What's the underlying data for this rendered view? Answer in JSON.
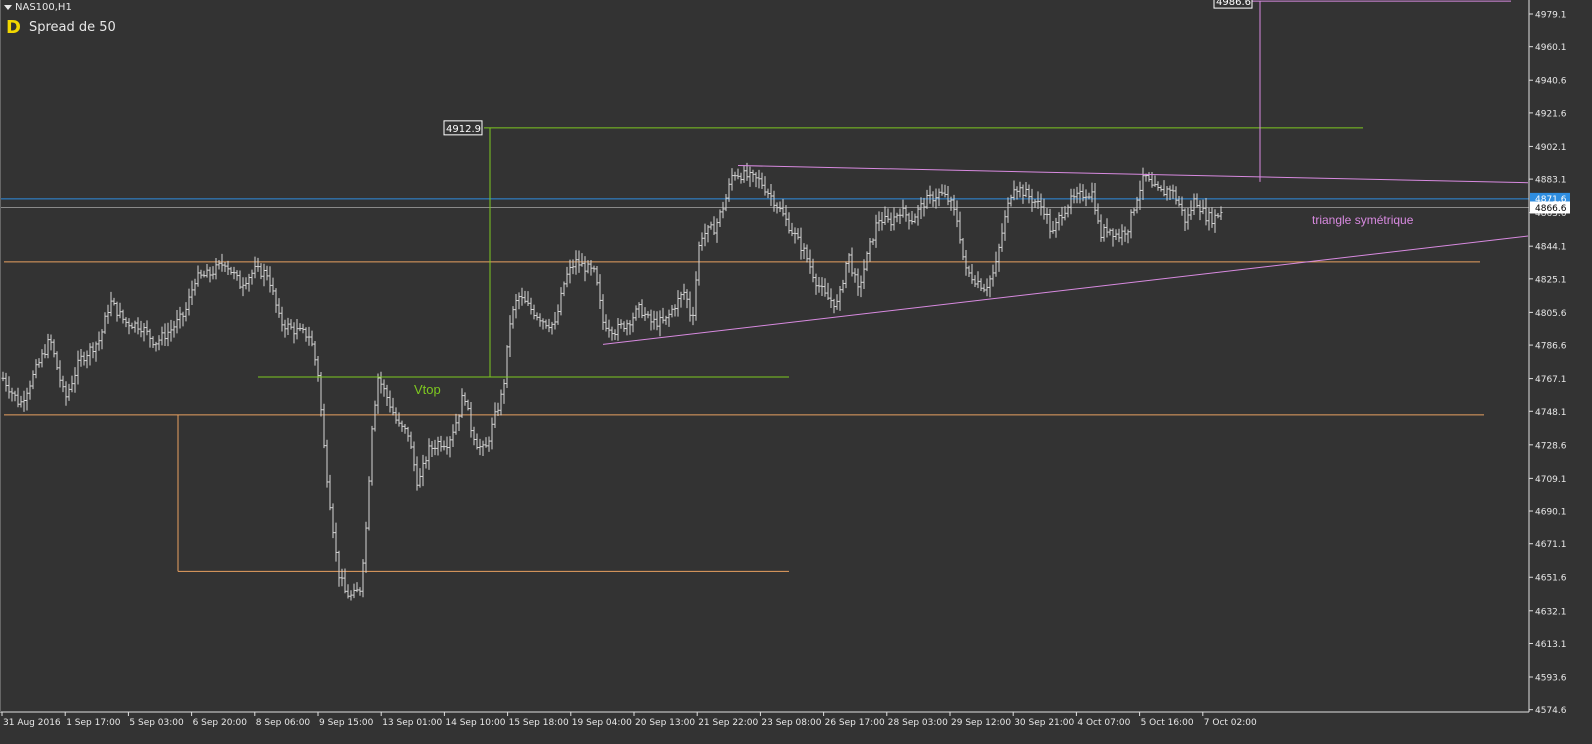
{
  "header": {
    "symbol": "NAS100,H1",
    "spread_text": "Spread de 50",
    "logo_letter": "D"
  },
  "colors": {
    "background": "#333333",
    "grid_text": "#e8e8e8",
    "bars": "#d4d4d4",
    "green": "#7ec820",
    "orange": "#e8a060",
    "violet": "#d88ae0",
    "blue": "#2e8de0",
    "price_line": "#8a8a8a",
    "axis": "#e0e0e0"
  },
  "price_axis": {
    "ticks": [
      "4979.1",
      "4960.1",
      "4940.6",
      "4921.6",
      "4902.1",
      "4883.1",
      "4863.6",
      "4844.1",
      "4825.1",
      "4805.6",
      "4786.6",
      "4767.1",
      "4748.1",
      "4728.6",
      "4709.1",
      "4690.1",
      "4671.1",
      "4651.6",
      "4632.1",
      "4613.1",
      "4593.6",
      "4574.6"
    ],
    "current_bid_label": "4866.6",
    "blue_line_label": "4871.6",
    "range": [
      4566,
      4992
    ]
  },
  "time_axis": {
    "labels": [
      "31 Aug 2016",
      "1 Sep 17:00",
      "5 Sep 03:00",
      "6 Sep 20:00",
      "8 Sep 06:00",
      "9 Sep 15:00",
      "13 Sep 01:00",
      "14 Sep 10:00",
      "15 Sep 18:00",
      "19 Sep 04:00",
      "20 Sep 13:00",
      "21 Sep 22:00",
      "23 Sep 08:00",
      "26 Sep 17:00",
      "28 Sep 03:00",
      "29 Sep 12:00",
      "30 Sep 21:00",
      "4 Oct 07:00",
      "5 Oct 16:00",
      "7 Oct 02:00"
    ]
  },
  "annotations": {
    "vtop_label": "Vtop",
    "vtop_target_label": "4912.9",
    "triangle_label": "triangle symétrique",
    "triangle_target_label": "4986.6"
  },
  "chart_data": {
    "type": "ohlc",
    "symbol": "NAS100",
    "timeframe": "H1",
    "anchors": [
      [
        0,
        4770
      ],
      [
        20,
        4752
      ],
      [
        50,
        4790
      ],
      [
        65,
        4755
      ],
      [
        80,
        4778
      ],
      [
        100,
        4790
      ],
      [
        110,
        4812
      ],
      [
        125,
        4800
      ],
      [
        140,
        4798
      ],
      [
        155,
        4788
      ],
      [
        170,
        4795
      ],
      [
        185,
        4805
      ],
      [
        195,
        4825
      ],
      [
        210,
        4828
      ],
      [
        225,
        4835
      ],
      [
        240,
        4822
      ],
      [
        255,
        4830
      ],
      [
        268,
        4828
      ],
      [
        280,
        4800
      ],
      [
        295,
        4795
      ],
      [
        310,
        4792
      ],
      [
        318,
        4770
      ],
      [
        325,
        4720
      ],
      [
        333,
        4680
      ],
      [
        338,
        4655
      ],
      [
        345,
        4643
      ],
      [
        352,
        4640
      ],
      [
        360,
        4645
      ],
      [
        366,
        4680
      ],
      [
        372,
        4740
      ],
      [
        378,
        4768
      ],
      [
        388,
        4755
      ],
      [
        398,
        4740
      ],
      [
        408,
        4735
      ],
      [
        418,
        4705
      ],
      [
        428,
        4725
      ],
      [
        438,
        4730
      ],
      [
        448,
        4730
      ],
      [
        458,
        4745
      ],
      [
        464,
        4760
      ],
      [
        470,
        4740
      ],
      [
        478,
        4728
      ],
      [
        485,
        4725
      ],
      [
        495,
        4745
      ],
      [
        503,
        4760
      ],
      [
        510,
        4800
      ],
      [
        518,
        4815
      ],
      [
        530,
        4808
      ],
      [
        545,
        4800
      ],
      [
        555,
        4798
      ],
      [
        565,
        4825
      ],
      [
        575,
        4835
      ],
      [
        585,
        4832
      ],
      [
        595,
        4828
      ],
      [
        603,
        4800
      ],
      [
        615,
        4795
      ],
      [
        628,
        4800
      ],
      [
        640,
        4808
      ],
      [
        650,
        4800
      ],
      [
        665,
        4800
      ],
      [
        675,
        4810
      ],
      [
        685,
        4818
      ],
      [
        692,
        4800
      ],
      [
        700,
        4850
      ],
      [
        715,
        4855
      ],
      [
        725,
        4870
      ],
      [
        733,
        4887
      ],
      [
        745,
        4885
      ],
      [
        760,
        4882
      ],
      [
        775,
        4870
      ],
      [
        785,
        4860
      ],
      [
        795,
        4850
      ],
      [
        805,
        4840
      ],
      [
        815,
        4825
      ],
      [
        825,
        4815
      ],
      [
        838,
        4810
      ],
      [
        848,
        4840
      ],
      [
        858,
        4818
      ],
      [
        868,
        4840
      ],
      [
        878,
        4860
      ],
      [
        890,
        4858
      ],
      [
        900,
        4865
      ],
      [
        912,
        4860
      ],
      [
        925,
        4870
      ],
      [
        940,
        4875
      ],
      [
        950,
        4870
      ],
      [
        958,
        4858
      ],
      [
        965,
        4830
      ],
      [
        975,
        4825
      ],
      [
        985,
        4820
      ],
      [
        995,
        4830
      ],
      [
        1003,
        4855
      ],
      [
        1013,
        4880
      ],
      [
        1025,
        4875
      ],
      [
        1035,
        4870
      ],
      [
        1045,
        4865
      ],
      [
        1052,
        4850
      ],
      [
        1060,
        4862
      ],
      [
        1070,
        4870
      ],
      [
        1085,
        4875
      ],
      [
        1093,
        4875
      ],
      [
        1100,
        4850
      ],
      [
        1108,
        4855
      ],
      [
        1118,
        4850
      ],
      [
        1128,
        4855
      ],
      [
        1138,
        4875
      ],
      [
        1145,
        4885
      ],
      [
        1152,
        4878
      ],
      [
        1162,
        4875
      ],
      [
        1170,
        4878
      ],
      [
        1178,
        4870
      ],
      [
        1186,
        4858
      ],
      [
        1195,
        4872
      ],
      [
        1205,
        4862
      ],
      [
        1213,
        4860
      ],
      [
        1222,
        4865
      ]
    ],
    "horizontal_levels": [
      {
        "name": "orange-support-upper",
        "price": 4835
      },
      {
        "name": "orange-support-lower",
        "price": 4746
      },
      {
        "name": "orange-low-projection",
        "price": 4655
      },
      {
        "name": "vtop-neckline",
        "price": 4768
      },
      {
        "name": "vtop-target",
        "price": 4912.9
      },
      {
        "name": "blue-level",
        "price": 4871.6
      },
      {
        "name": "bid-line",
        "price": 4866.6
      }
    ],
    "trendlines": [
      {
        "name": "triangle-upper",
        "from": [
          738,
          4891
        ],
        "to": [
          1528,
          4881
        ]
      },
      {
        "name": "triangle-lower",
        "from": [
          603,
          4787
        ],
        "to": [
          1528,
          4850
        ]
      }
    ],
    "triangle_target": 4986.6
  }
}
